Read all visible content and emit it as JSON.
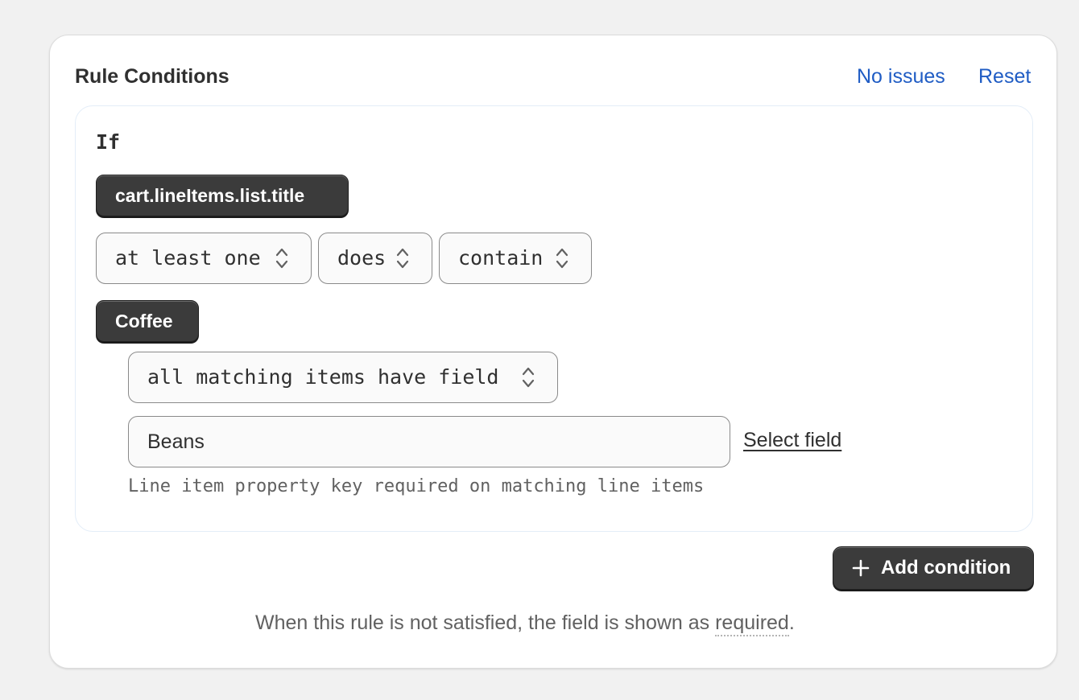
{
  "card": {
    "title": "Rule Conditions",
    "issues_link": "No issues",
    "reset_link": "Reset"
  },
  "condition": {
    "if_label": "If",
    "field_chip": "cart.lineItems.list.title",
    "quantifier": "at least one",
    "negation": "does",
    "operator": "contain",
    "value_chip": "Coffee",
    "match_mode": "all matching items have field",
    "property_key_value": "Beans",
    "select_field_link": "Select field",
    "help_text": "Line item property key required on matching line items"
  },
  "actions": {
    "add_condition": "Add condition"
  },
  "footer": {
    "note_prefix": "When this rule is not satisfied, the field is shown as ",
    "note_required": "required",
    "note_suffix": "."
  },
  "colors": {
    "link": "#1f5cc4",
    "chip_bg": "#3b3b3b",
    "page_bg": "#f1f1f1"
  },
  "icons": {
    "select_chevron": "chevron-up-down-icon",
    "add": "plus-icon"
  }
}
